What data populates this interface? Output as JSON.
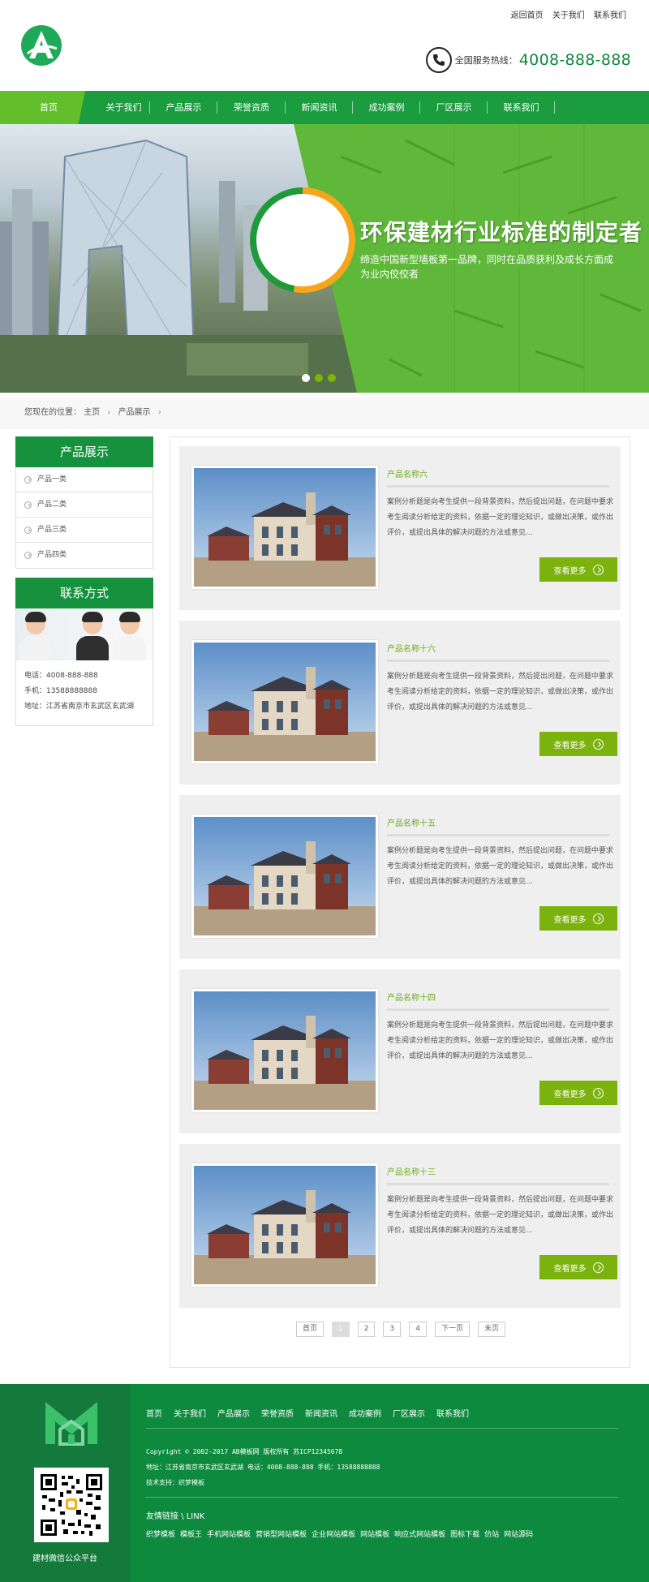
{
  "header": {
    "top_links": [
      "返回首页",
      "关于我们",
      "联系我们"
    ],
    "hotline_label": "全国服务热线：",
    "hotline_number": "4008-888-888"
  },
  "nav": {
    "items": [
      {
        "label": "首页",
        "active": true
      },
      {
        "label": "关于我们"
      },
      {
        "label": "产品展示"
      },
      {
        "label": "荣誉资质"
      },
      {
        "label": "新闻资讯"
      },
      {
        "label": "成功案例"
      },
      {
        "label": "厂区展示"
      },
      {
        "label": "联系我们"
      }
    ]
  },
  "banner": {
    "title": "环保建材行业标准的制定者",
    "subtitle": "缔造中国新型墙板第一品牌，同时在品质获利及成长方面成为业内佼佼者"
  },
  "breadcrumb": {
    "prefix": "您现在的位置：",
    "items": [
      "主页",
      "产品展示"
    ]
  },
  "sidebar": {
    "products_title": "产品展示",
    "categories": [
      "产品一类",
      "产品二类",
      "产品三类",
      "产品四类"
    ],
    "contact_title": "联系方式",
    "phone": "电话：4008-888-888",
    "mobile": "手机：13588888888",
    "address": "地址：江苏省南京市玄武区玄武湖"
  },
  "products": {
    "more_label": "查看更多",
    "items": [
      {
        "title": "产品名称六",
        "desc": "案例分析题是向考生提供一段背景资料，然后提出问题，在问题中要求考生阅读分析给定的资料，依据一定的理论知识，或做出决策，或作出评价，或提出具体的解决问题的方法或意见..."
      },
      {
        "title": "产品名称十六",
        "desc": "案例分析题是向考生提供一段背景资料，然后提出问题，在问题中要求考生阅读分析给定的资料，依据一定的理论知识，或做出决策，或作出评价，或提出具体的解决问题的方法或意见..."
      },
      {
        "title": "产品名称十五",
        "desc": "案例分析题是向考生提供一段背景资料，然后提出问题，在问题中要求考生阅读分析给定的资料，依据一定的理论知识，或做出决策，或作出评价，或提出具体的解决问题的方法或意见..."
      },
      {
        "title": "产品名称十四",
        "desc": "案例分析题是向考生提供一段背景资料，然后提出问题，在问题中要求考生阅读分析给定的资料，依据一定的理论知识，或做出决策，或作出评价，或提出具体的解决问题的方法或意见..."
      },
      {
        "title": "产品名称十三",
        "desc": "案例分析题是向考生提供一段背景资料，然后提出问题，在问题中要求考生阅读分析给定的资料，依据一定的理论知识，或做出决策，或作出评价，或提出具体的解决问题的方法或意见..."
      }
    ]
  },
  "pagination": {
    "items": [
      {
        "label": "首页"
      },
      {
        "label": "1",
        "current": true
      },
      {
        "label": "2"
      },
      {
        "label": "3"
      },
      {
        "label": "4"
      },
      {
        "label": "下一页"
      },
      {
        "label": "末页"
      }
    ]
  },
  "footer": {
    "nav": [
      "首页",
      "关于我们",
      "产品展示",
      "荣誉资质",
      "新闻资讯",
      "成功案例",
      "厂区展示",
      "联系我们"
    ],
    "copyright": "Copyright © 2002-2017 AB模板网 版权所有 苏ICP12345678",
    "address": "地址：江苏省南京市玄武区玄武湖 电话：4008-888-888 手机：13588888888",
    "tech": "技术支持：织梦模板",
    "links_title": "友情链接 \\ LINK",
    "links": [
      "织梦模板",
      "模板王",
      "手机网站模板",
      "营销型网站模板",
      "企业网站模板",
      "网站模板",
      "响应式网站模板",
      "图标下载",
      "仿站",
      "网站源码"
    ],
    "qr_caption": "建材微信公众平台"
  },
  "colors": {
    "brand_green": "#1a9c3f",
    "light_green": "#63be2c",
    "button_green": "#7cb20e",
    "footer_green": "#0e8a3f",
    "banner_dot_active": "#ffffff",
    "banner_dot": "#7ab800"
  },
  "icons": {
    "phone": "phone-icon",
    "list_bullet": "circle-chevron-right-icon",
    "more_arrow": "circle-chevron-right-icon"
  }
}
